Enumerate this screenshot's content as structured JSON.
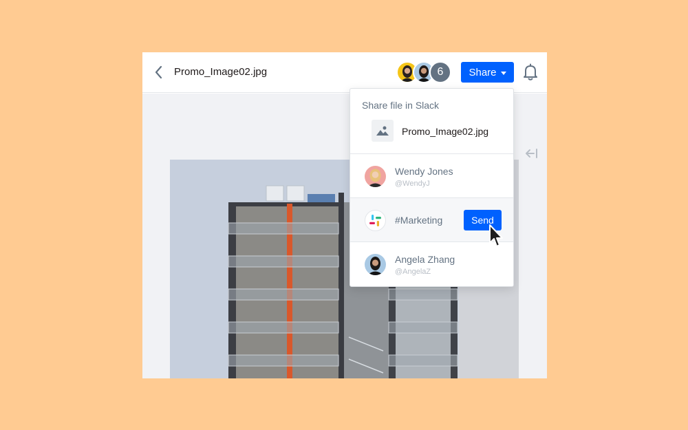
{
  "window": {
    "filename": "Promo_Image02.jpg"
  },
  "header": {
    "collaborators": [
      {
        "name": "collaborator-1"
      },
      {
        "name": "collaborator-2"
      }
    ],
    "more_count": "6",
    "share_label": "Share",
    "icons": [
      "back-arrow-icon",
      "bell-icon",
      "collapse-panel-icon"
    ]
  },
  "share_popover": {
    "title": "Share file in Slack",
    "file_name": "Promo_Image02.jpg",
    "recipients": [
      {
        "name": "Wendy Jones",
        "handle": "@WendyJ",
        "type": "person"
      },
      {
        "name": "#Marketing",
        "type": "channel",
        "icon": "slack-logo"
      },
      {
        "name": "Angela Zhang",
        "handle": "@AngelaZ",
        "type": "person"
      }
    ],
    "send_label": "Send"
  },
  "colors": {
    "background": "#FFCB92",
    "accent": "#0061FE",
    "muted_text": "#637282"
  }
}
